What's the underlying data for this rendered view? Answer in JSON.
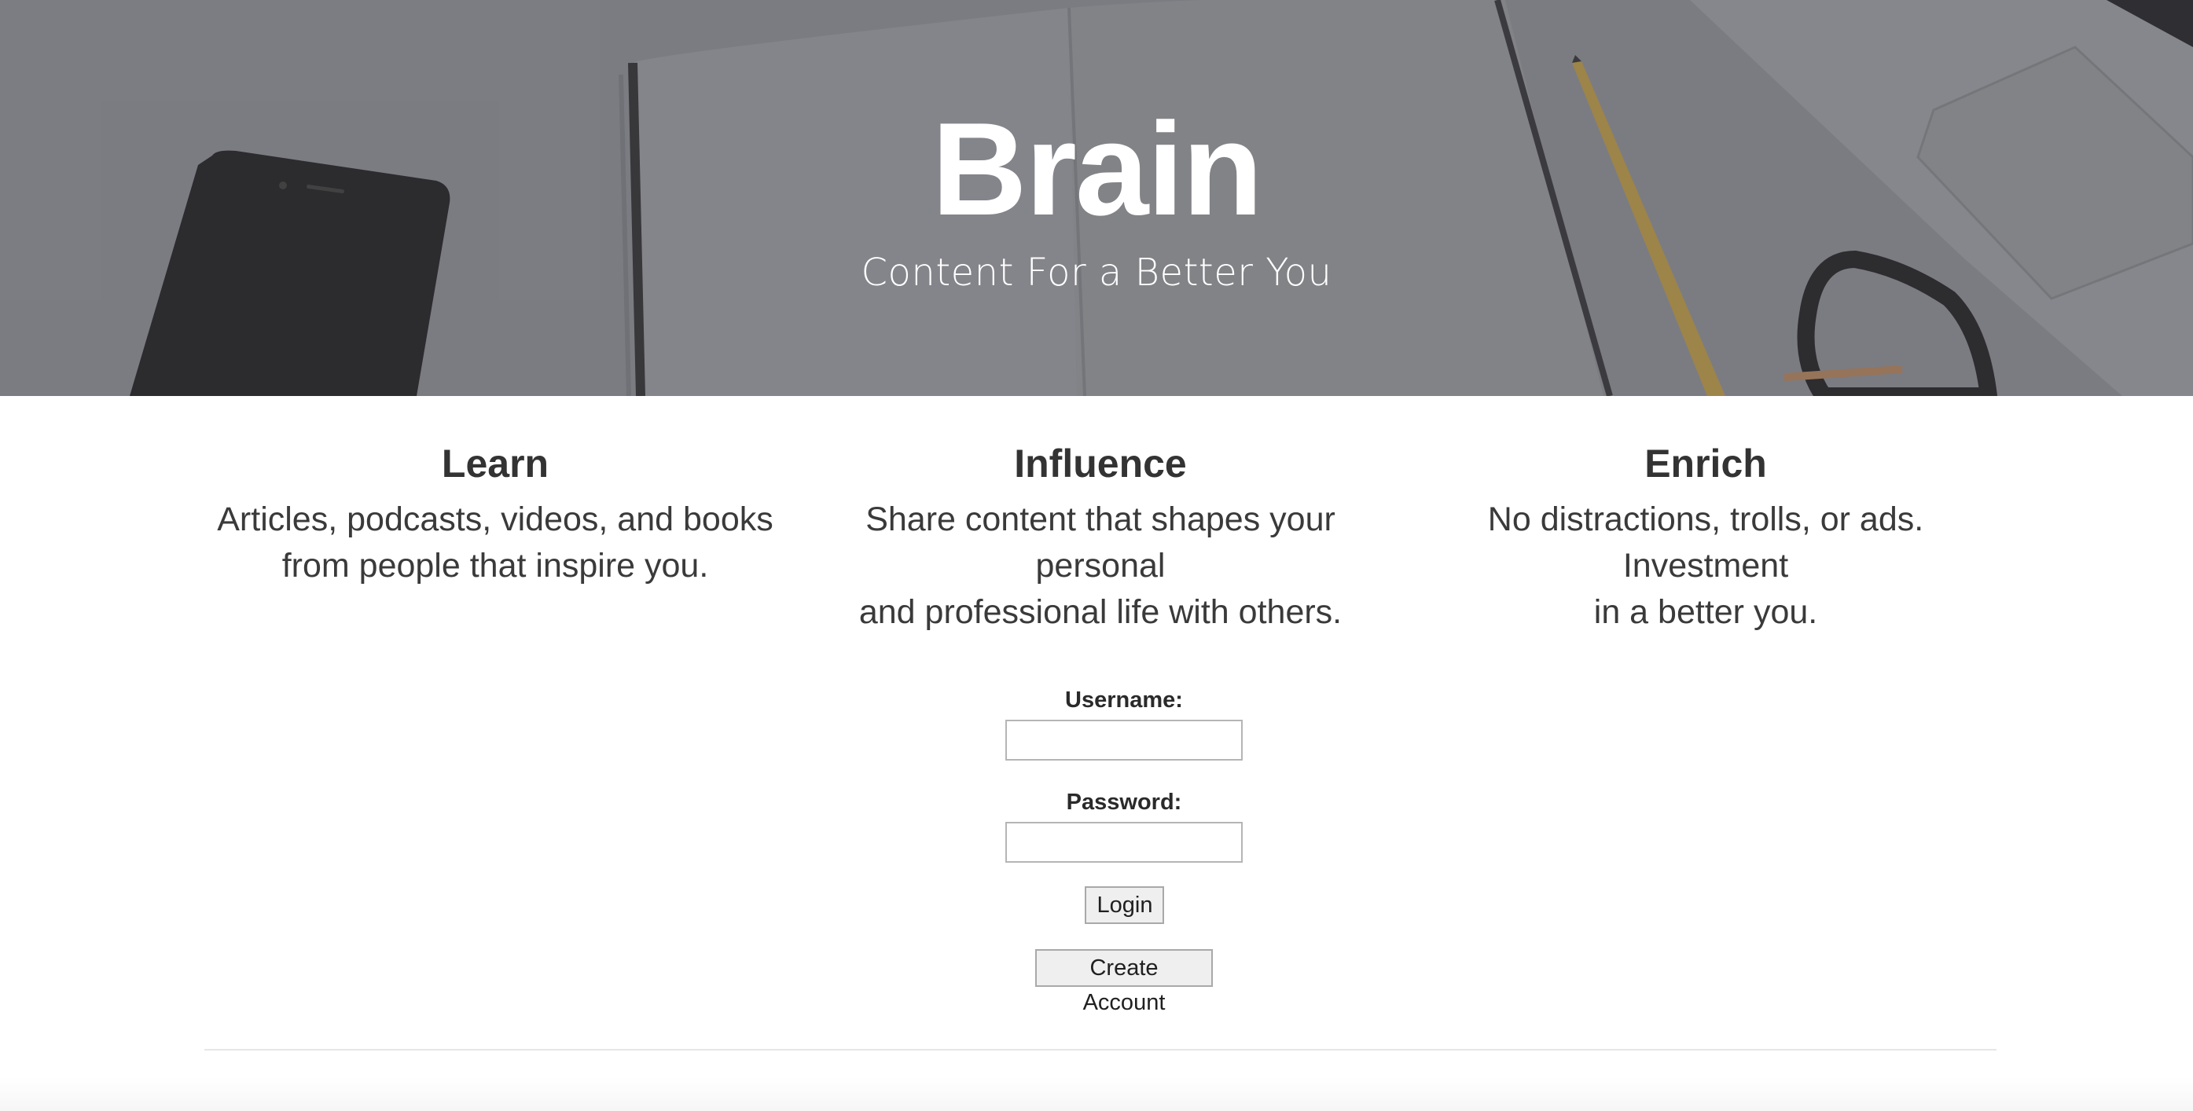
{
  "hero": {
    "title": "Brain",
    "subtitle": "Content For a Better You"
  },
  "features": [
    {
      "heading": "Learn",
      "line1": "Articles, podcasts, videos, and books",
      "line2": "from people that inspire you."
    },
    {
      "heading": "Influence",
      "line1": "Share content that shapes your personal",
      "line2": "and professional life with others."
    },
    {
      "heading": "Enrich",
      "line1": "No distractions, trolls, or ads. Investment",
      "line2": "in a better you."
    }
  ],
  "login_form": {
    "username_label": "Username:",
    "username_value": "",
    "password_label": "Password:",
    "password_value": "",
    "login_button": "Login",
    "create_account_button": "Create Account"
  },
  "colors": {
    "hero_overlay": "#828388",
    "text": "#333333",
    "button_bg": "#efefef",
    "divider": "#e6e6e6"
  }
}
